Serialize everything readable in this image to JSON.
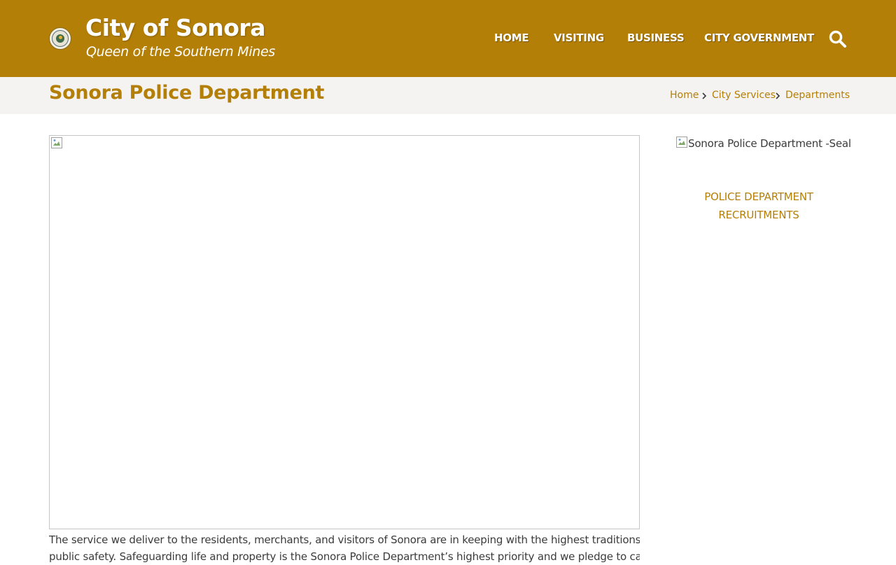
{
  "header": {
    "site_title": "City of Sonora",
    "tagline": "Queen of the Southern Mines",
    "logo_icon": "city-seal-icon",
    "nav": [
      {
        "label": "HOME"
      },
      {
        "label": "VISITING"
      },
      {
        "label": "BUSINESS"
      },
      {
        "label": "CITY GOVERNMENT"
      }
    ],
    "search_icon": "search-icon"
  },
  "page": {
    "title": "Sonora Police Department",
    "breadcrumb": [
      {
        "label": "Home"
      },
      {
        "label": "City Services"
      },
      {
        "label": "Departments"
      }
    ]
  },
  "main": {
    "paragraph_lines": [
      "The service we deliver to the residents, merchants, and visitors of Sonora are in keeping with the highest traditions of",
      "public safety.  Safeguarding life and property is the Sonora Police Department’s highest priority and we pledge to carry out"
    ]
  },
  "sidebar": {
    "seal_alt": "Sonora Police Department -Seal",
    "recruit_line1": "POLICE DEPARTMENT",
    "recruit_line2": "RECRUITMENTS"
  },
  "colors": {
    "header_bg": "#b47f07",
    "accent": "#b47f07",
    "subbar_bg": "#f4f3f1",
    "text": "#3b3b3b"
  }
}
